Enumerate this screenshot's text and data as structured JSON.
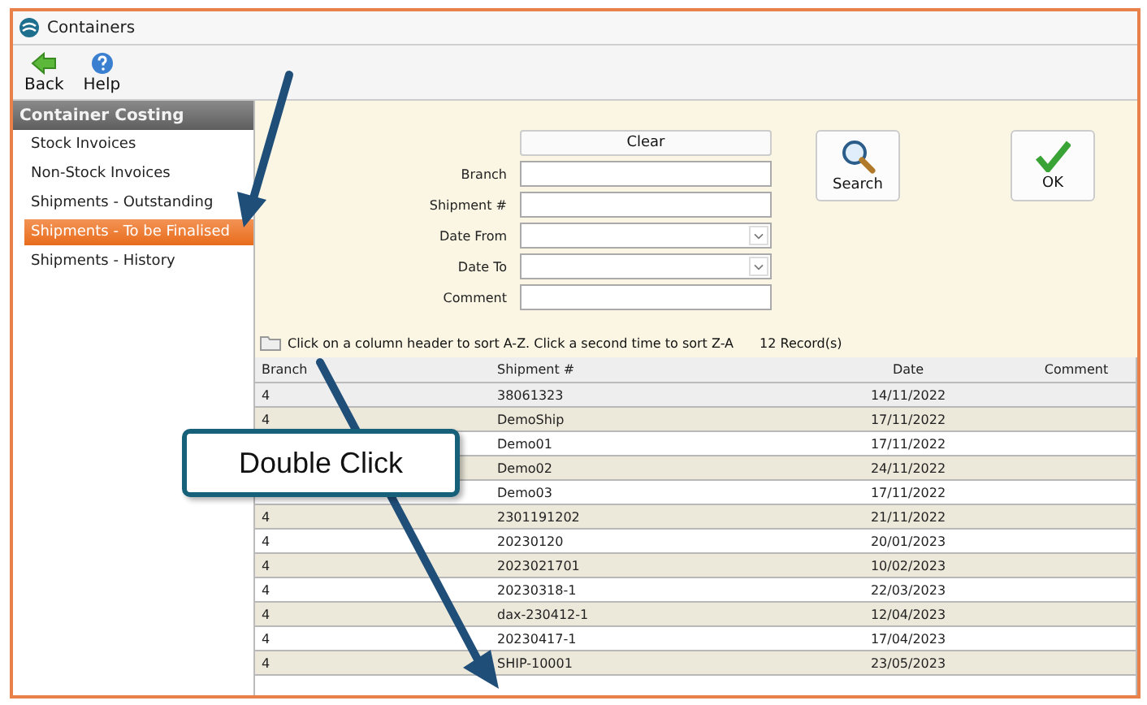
{
  "window": {
    "title": "Containers"
  },
  "toolbar": [
    {
      "label": "Back",
      "kind": "back"
    },
    {
      "label": "Help",
      "kind": "help"
    }
  ],
  "sidebar": {
    "title": "Container Costing",
    "items": [
      {
        "label": "Stock Invoices",
        "selected": false
      },
      {
        "label": "Non-Stock Invoices",
        "selected": false
      },
      {
        "label": "Shipments - Outstanding",
        "selected": false
      },
      {
        "label": "Shipments - To be Finalised",
        "selected": true
      },
      {
        "label": "Shipments - History",
        "selected": false
      }
    ]
  },
  "form": {
    "clear": "Clear",
    "fields": [
      {
        "label": "Branch",
        "kind": "text"
      },
      {
        "label": "Shipment #",
        "kind": "text"
      },
      {
        "label": "Date From",
        "kind": "dropdown"
      },
      {
        "label": "Date To",
        "kind": "dropdown"
      },
      {
        "label": "Comment",
        "kind": "text"
      }
    ],
    "buttons": [
      {
        "label": "Search",
        "kind": "search"
      },
      {
        "label": "OK",
        "kind": "ok"
      }
    ]
  },
  "hint": "Click on a column header to sort A-Z. Click a second time to sort Z-A",
  "record_count": "12 Record(s)",
  "table": {
    "columns": [
      "Branch",
      "Shipment #",
      "Date",
      "Comment"
    ],
    "rows": [
      {
        "branch": "4",
        "shipment": "38061323",
        "date": "14/11/2022",
        "selected": true
      },
      {
        "branch": "4",
        "shipment": "DemoShip",
        "date": "17/11/2022",
        "selected": false
      },
      {
        "shipment": "Demo01",
        "date": "17/11/2022",
        "selected": false
      },
      {
        "shipment": "Demo02",
        "date": "24/11/2022",
        "selected": false
      },
      {
        "shipment": "Demo03",
        "date": "17/11/2022",
        "selected": false
      },
      {
        "branch": "4",
        "shipment": "2301191202",
        "date": "21/11/2022",
        "selected": false
      },
      {
        "branch": "4",
        "shipment": "20230120",
        "date": "20/01/2023",
        "selected": false
      },
      {
        "branch": "4",
        "shipment": "2023021701",
        "date": "10/02/2023",
        "selected": false
      },
      {
        "branch": "4",
        "shipment": "20230318-1",
        "date": "22/03/2023",
        "selected": false
      },
      {
        "branch": "4",
        "shipment": "dax-230412-1",
        "date": "12/04/2023",
        "selected": false
      },
      {
        "branch": "4",
        "shipment": "20230417-1",
        "date": "17/04/2023",
        "selected": false
      },
      {
        "branch": "4",
        "shipment": "SHIP-10001",
        "date": "23/05/2023",
        "selected": false
      }
    ]
  },
  "annotation": {
    "callout": "Double Click"
  }
}
